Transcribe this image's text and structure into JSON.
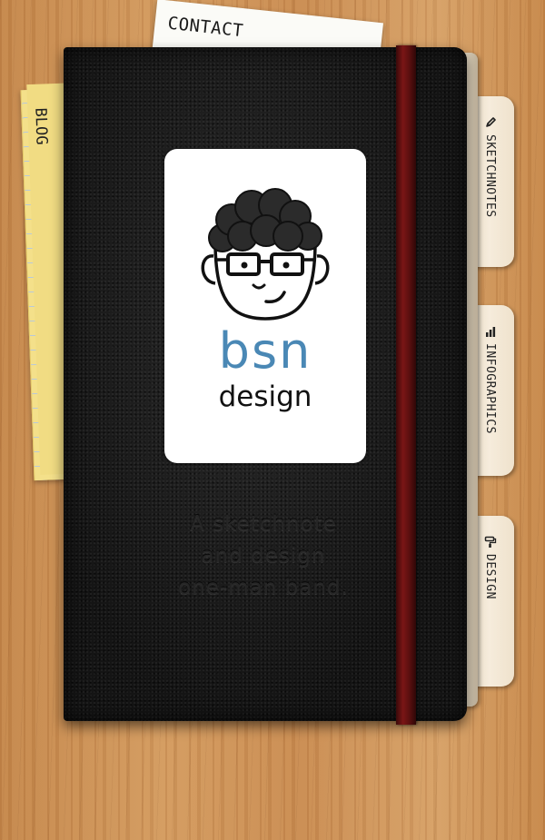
{
  "contact": {
    "label": "CONTACT"
  },
  "blog": {
    "label": "BLOG"
  },
  "tabs": [
    {
      "label": "SKETCHNOTES",
      "icon": "pencil-icon"
    },
    {
      "label": "INFOGRAPHICS",
      "icon": "bar-chart-icon"
    },
    {
      "label": "DESIGN",
      "icon": "paint-roller-icon"
    }
  ],
  "logo": {
    "bsn": "bsn",
    "design": "design",
    "bsn_color": "#4a88b5"
  },
  "tagline": {
    "line1": "A sketchnote",
    "line2": "and design",
    "line3": "one-man band."
  },
  "colors": {
    "notebook": "#141414",
    "band": "#6a1212",
    "pad": "#f4e08a",
    "tab": "#f3e8d6"
  }
}
